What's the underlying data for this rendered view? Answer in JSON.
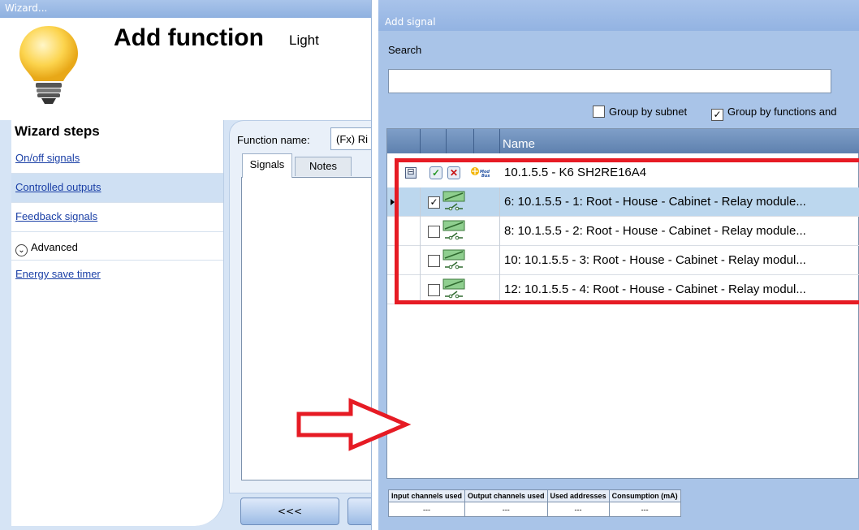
{
  "wizard": {
    "window_title": "Wizard...",
    "title": "Add function",
    "subtitle": "Light",
    "steps_title": "Wizard steps",
    "steps": [
      {
        "label": "On/off signals"
      },
      {
        "label": "Controlled outputs"
      },
      {
        "label": "Feedback signals"
      }
    ],
    "advanced_label": "Advanced",
    "energy_step": "Energy save timer",
    "function_name_label": "Function name:",
    "function_name_value": "(Fx) Ri",
    "tabs": [
      {
        "label": "Signals"
      },
      {
        "label": "Notes"
      }
    ],
    "prev_button": "<<<",
    "next_button": ""
  },
  "add_signal": {
    "window_title": "Add signal",
    "search_label": "Search",
    "search_value": "",
    "group_by_subnet": {
      "label": "Group by subnet",
      "checked": false
    },
    "group_by_functions": {
      "label": "Group by functions and",
      "checked": true
    },
    "column_name": "Name",
    "group_row": {
      "text": "10.1.5.5 - K6 SH2RE16A4",
      "expand_symbol": "⊟"
    },
    "rows": [
      {
        "text": "6: 10.1.5.5 - 1: Root - House - Cabinet - Relay module...",
        "checked": true,
        "selected": true
      },
      {
        "text": "8: 10.1.5.5 - 2: Root - House - Cabinet - Relay module...",
        "checked": false,
        "selected": false
      },
      {
        "text": "10: 10.1.5.5 - 3: Root - House - Cabinet - Relay modul...",
        "checked": false,
        "selected": false
      },
      {
        "text": "12: 10.1.5.5 - 4: Root - House - Cabinet - Relay modul...",
        "checked": false,
        "selected": false
      }
    ],
    "status_columns": [
      "Input channels used",
      "Output channels used",
      "Used addresses",
      "Consumption (mA)"
    ],
    "status_values": [
      "---",
      "---",
      "---",
      "---"
    ]
  },
  "colors": {
    "highlight_frame": "#e61b24",
    "arrow": "#e61b24",
    "selected_row": "#bcd7ee",
    "header": "#6a8cba"
  }
}
